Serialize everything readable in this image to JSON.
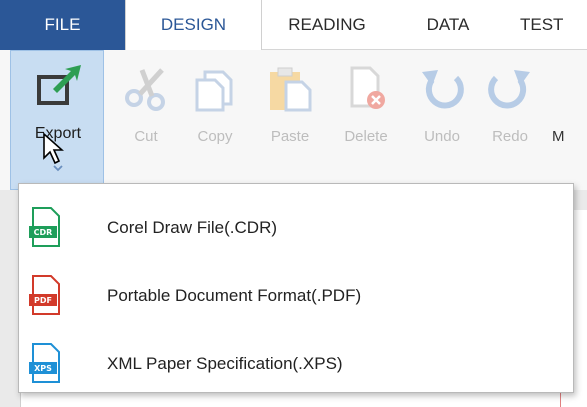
{
  "ribbon": {
    "tabs": [
      {
        "label": "FILE"
      },
      {
        "label": "DESIGN"
      },
      {
        "label": "READING"
      },
      {
        "label": "DATA"
      },
      {
        "label": "TEST"
      }
    ],
    "active_tab": "DESIGN",
    "tools": [
      {
        "label": "Export",
        "icon": "export-icon",
        "enabled": true
      },
      {
        "label": "Cut",
        "icon": "scissors-icon",
        "enabled": false
      },
      {
        "label": "Copy",
        "icon": "copy-icon",
        "enabled": false
      },
      {
        "label": "Paste",
        "icon": "paste-icon",
        "enabled": false
      },
      {
        "label": "Delete",
        "icon": "delete-page-icon",
        "enabled": false
      },
      {
        "label": "Undo",
        "icon": "undo-icon",
        "enabled": false
      },
      {
        "label": "Redo",
        "icon": "redo-icon",
        "enabled": false
      }
    ]
  },
  "export_menu": {
    "items": [
      {
        "label": "Corel Draw File(.CDR)",
        "badge": "CDR",
        "color": "#1e9e5a"
      },
      {
        "label": "Portable Document Format(.PDF)",
        "badge": "PDF",
        "color": "#d23a2a"
      },
      {
        "label": "XML Paper Specification(.XPS)",
        "badge": "XPS",
        "color": "#1e90d6"
      }
    ]
  },
  "colors": {
    "file_tab": "#2b5797",
    "export_highlight": "#c8ddf2",
    "disabled_icon": "#c5d3e6"
  }
}
